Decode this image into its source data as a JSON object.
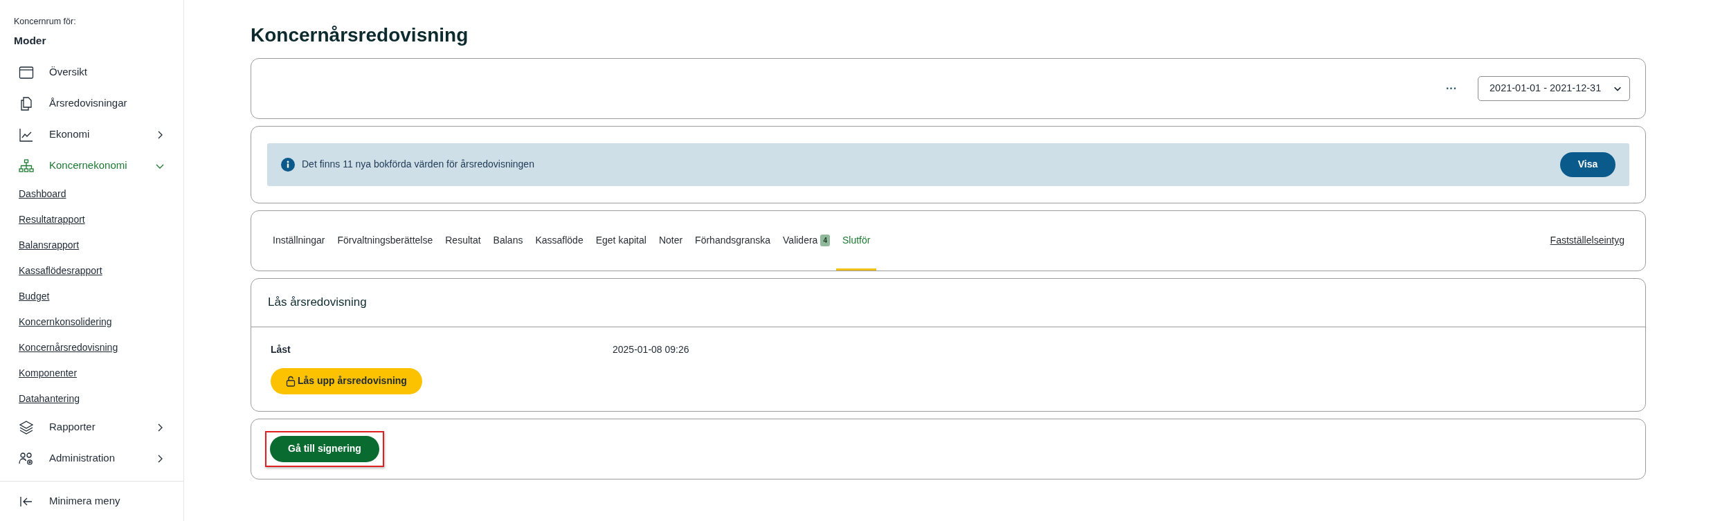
{
  "sidebar": {
    "caption": "Koncernrum för:",
    "company": "Moder",
    "items": [
      {
        "label": "Översikt",
        "kind": "link",
        "selected": false
      },
      {
        "label": "Årsredovisningar",
        "kind": "link",
        "selected": false
      },
      {
        "label": "Ekonomi",
        "kind": "group",
        "expanded": false,
        "selected": false
      },
      {
        "label": "Koncernekonomi",
        "kind": "group",
        "expanded": true,
        "selected": true,
        "children": [
          {
            "label": "Dashboard"
          },
          {
            "label": "Resultatrapport"
          },
          {
            "label": "Balansrapport"
          },
          {
            "label": "Kassaflödesrapport"
          },
          {
            "label": "Budget"
          },
          {
            "label": "Koncernkonsolidering"
          },
          {
            "label": "Koncernårsredovisning"
          },
          {
            "label": "Komponenter"
          },
          {
            "label": "Datahantering"
          }
        ]
      },
      {
        "label": "Rapporter",
        "kind": "group",
        "expanded": false,
        "selected": false
      },
      {
        "label": "Administration",
        "kind": "group",
        "expanded": false,
        "selected": false
      }
    ],
    "footer": "Minimera meny"
  },
  "page_title": "Koncernårsredovisning",
  "toolbar": {
    "more": "···",
    "period": "2021-01-01 - 2021-12-31"
  },
  "notice": {
    "text": "Det finns 11 nya bokförda värden för årsredovisningen",
    "button": "Visa"
  },
  "tabs": [
    {
      "label": "Inställningar",
      "selected": false
    },
    {
      "label": "Förvaltningsberättelse",
      "selected": false
    },
    {
      "label": "Resultat",
      "selected": false
    },
    {
      "label": "Balans",
      "selected": false
    },
    {
      "label": "Kassaflöde",
      "selected": false
    },
    {
      "label": "Eget kapital",
      "selected": false
    },
    {
      "label": "Noter",
      "selected": false
    },
    {
      "label": "Förhandsgranska",
      "selected": false
    },
    {
      "label": "Validera",
      "badge": "4",
      "selected": false
    },
    {
      "label": "Slutför",
      "selected": true
    }
  ],
  "tab_link": "Fastställelseintyg",
  "lock": {
    "title": "Lås årsredovisning",
    "rows": [
      {
        "label": "Låst",
        "value": "2025-01-08 09:26"
      }
    ],
    "button": "Lås upp årsredovisning"
  },
  "sign": {
    "button": "Gå till signering",
    "highlighted": true
  }
}
